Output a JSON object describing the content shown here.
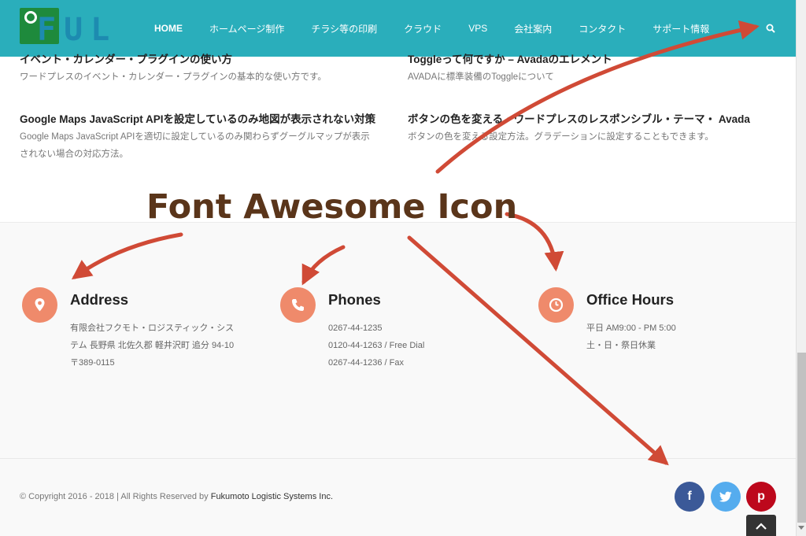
{
  "brand": {
    "logo_text": "FUL",
    "colors": {
      "header": "#2aaebb",
      "logo_green": "#1e8a3c",
      "logo_blue": "#1d8bb0",
      "icon_circle": "#ef8a6b",
      "arrow": "#d04a36",
      "label": "#5a351a"
    }
  },
  "nav": {
    "items": [
      "HOME",
      "ホームページ制作",
      "チラシ等の印刷",
      "クラウド",
      "VPS",
      "会社案内",
      "コンタクト",
      "サポート情報"
    ],
    "search_icon": "search-icon"
  },
  "posts": [
    {
      "title": "イベント・カレンダー・プラグインの使い方",
      "desc": "ワードプレスのイベント・カレンダー・プラグインの基本的な使い方です。"
    },
    {
      "title": "Toggleって何ですか – Avadaのエレメント",
      "desc": "AVADAに標準装備のToggleについて"
    },
    {
      "title": "Google Maps JavaScript APIを設定しているのみ地図が表示されない対策",
      "desc_lines": [
        "Google Maps JavaScript APIを適切に設定しているのみ関わらずグーグルマップが表示",
        "されない場合の対応方法。"
      ]
    },
    {
      "title": "ボタンの色を変える・ワードプレスのレスポンシブル・テーマ・ Avada",
      "desc": "ボタンの色を変える設定方法。グラデーションに設定することもできます。"
    }
  ],
  "contact": {
    "address": {
      "title": "Address",
      "icon": "map-marker-icon",
      "lines": [
        "有限会社フクモト・ロジスティック・シス",
        "テム 長野県 北佐久郡 軽井沢町 追分 94-10",
        "〒389-0115"
      ]
    },
    "phones": {
      "title": "Phones",
      "icon": "phone-icon",
      "lines": [
        "0267-44-1235",
        "0120-44-1263 / Free Dial",
        "0267-44-1236 / Fax"
      ]
    },
    "hours": {
      "title": "Office Hours",
      "icon": "clock-icon",
      "lines": [
        "平日 AM9:00 - PM 5:00",
        "土・日・祭日休業"
      ]
    }
  },
  "footer": {
    "copyright_prefix": "© Copyright 2016 - 2018 | All Rights Reserved by",
    "company": "Fukumoto Logistic Systems Inc.",
    "social": [
      {
        "name": "facebook",
        "glyph": "f",
        "color": "#3b5998"
      },
      {
        "name": "twitter",
        "glyph": "t",
        "color": "#55acee"
      },
      {
        "name": "pinterest",
        "glyph": "p",
        "color": "#bd081c"
      }
    ],
    "to_top_icon": "chevron-up-icon"
  },
  "annotation": {
    "label": "Font Awesome Icon"
  }
}
